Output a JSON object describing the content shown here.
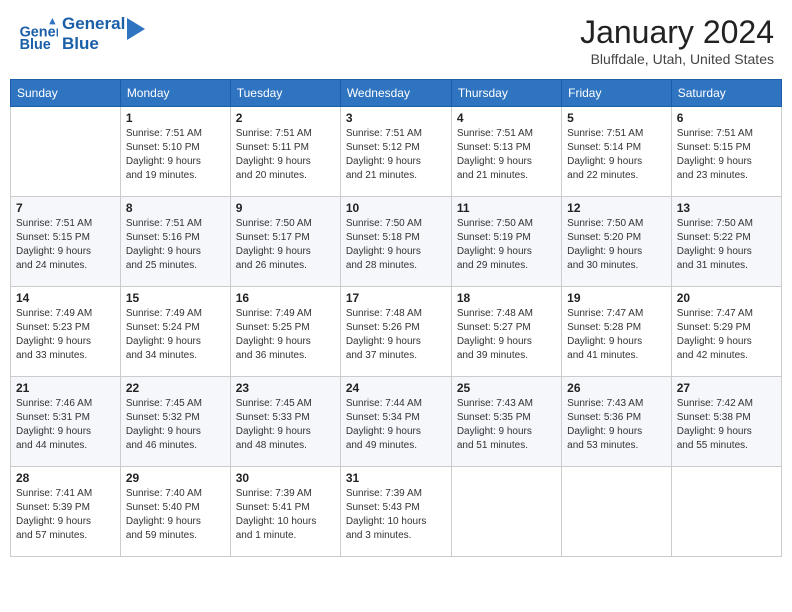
{
  "header": {
    "logo": {
      "line1": "General",
      "line2": "Blue"
    },
    "title": "January 2024",
    "location": "Bluffdale, Utah, United States"
  },
  "weekdays": [
    "Sunday",
    "Monday",
    "Tuesday",
    "Wednesday",
    "Thursday",
    "Friday",
    "Saturday"
  ],
  "weeks": [
    [
      {
        "day": "",
        "info": ""
      },
      {
        "day": "1",
        "info": "Sunrise: 7:51 AM\nSunset: 5:10 PM\nDaylight: 9 hours\nand 19 minutes."
      },
      {
        "day": "2",
        "info": "Sunrise: 7:51 AM\nSunset: 5:11 PM\nDaylight: 9 hours\nand 20 minutes."
      },
      {
        "day": "3",
        "info": "Sunrise: 7:51 AM\nSunset: 5:12 PM\nDaylight: 9 hours\nand 21 minutes."
      },
      {
        "day": "4",
        "info": "Sunrise: 7:51 AM\nSunset: 5:13 PM\nDaylight: 9 hours\nand 21 minutes."
      },
      {
        "day": "5",
        "info": "Sunrise: 7:51 AM\nSunset: 5:14 PM\nDaylight: 9 hours\nand 22 minutes."
      },
      {
        "day": "6",
        "info": "Sunrise: 7:51 AM\nSunset: 5:15 PM\nDaylight: 9 hours\nand 23 minutes."
      }
    ],
    [
      {
        "day": "7",
        "info": "Sunrise: 7:51 AM\nSunset: 5:15 PM\nDaylight: 9 hours\nand 24 minutes."
      },
      {
        "day": "8",
        "info": "Sunrise: 7:51 AM\nSunset: 5:16 PM\nDaylight: 9 hours\nand 25 minutes."
      },
      {
        "day": "9",
        "info": "Sunrise: 7:50 AM\nSunset: 5:17 PM\nDaylight: 9 hours\nand 26 minutes."
      },
      {
        "day": "10",
        "info": "Sunrise: 7:50 AM\nSunset: 5:18 PM\nDaylight: 9 hours\nand 28 minutes."
      },
      {
        "day": "11",
        "info": "Sunrise: 7:50 AM\nSunset: 5:19 PM\nDaylight: 9 hours\nand 29 minutes."
      },
      {
        "day": "12",
        "info": "Sunrise: 7:50 AM\nSunset: 5:20 PM\nDaylight: 9 hours\nand 30 minutes."
      },
      {
        "day": "13",
        "info": "Sunrise: 7:50 AM\nSunset: 5:22 PM\nDaylight: 9 hours\nand 31 minutes."
      }
    ],
    [
      {
        "day": "14",
        "info": "Sunrise: 7:49 AM\nSunset: 5:23 PM\nDaylight: 9 hours\nand 33 minutes."
      },
      {
        "day": "15",
        "info": "Sunrise: 7:49 AM\nSunset: 5:24 PM\nDaylight: 9 hours\nand 34 minutes."
      },
      {
        "day": "16",
        "info": "Sunrise: 7:49 AM\nSunset: 5:25 PM\nDaylight: 9 hours\nand 36 minutes."
      },
      {
        "day": "17",
        "info": "Sunrise: 7:48 AM\nSunset: 5:26 PM\nDaylight: 9 hours\nand 37 minutes."
      },
      {
        "day": "18",
        "info": "Sunrise: 7:48 AM\nSunset: 5:27 PM\nDaylight: 9 hours\nand 39 minutes."
      },
      {
        "day": "19",
        "info": "Sunrise: 7:47 AM\nSunset: 5:28 PM\nDaylight: 9 hours\nand 41 minutes."
      },
      {
        "day": "20",
        "info": "Sunrise: 7:47 AM\nSunset: 5:29 PM\nDaylight: 9 hours\nand 42 minutes."
      }
    ],
    [
      {
        "day": "21",
        "info": "Sunrise: 7:46 AM\nSunset: 5:31 PM\nDaylight: 9 hours\nand 44 minutes."
      },
      {
        "day": "22",
        "info": "Sunrise: 7:45 AM\nSunset: 5:32 PM\nDaylight: 9 hours\nand 46 minutes."
      },
      {
        "day": "23",
        "info": "Sunrise: 7:45 AM\nSunset: 5:33 PM\nDaylight: 9 hours\nand 48 minutes."
      },
      {
        "day": "24",
        "info": "Sunrise: 7:44 AM\nSunset: 5:34 PM\nDaylight: 9 hours\nand 49 minutes."
      },
      {
        "day": "25",
        "info": "Sunrise: 7:43 AM\nSunset: 5:35 PM\nDaylight: 9 hours\nand 51 minutes."
      },
      {
        "day": "26",
        "info": "Sunrise: 7:43 AM\nSunset: 5:36 PM\nDaylight: 9 hours\nand 53 minutes."
      },
      {
        "day": "27",
        "info": "Sunrise: 7:42 AM\nSunset: 5:38 PM\nDaylight: 9 hours\nand 55 minutes."
      }
    ],
    [
      {
        "day": "28",
        "info": "Sunrise: 7:41 AM\nSunset: 5:39 PM\nDaylight: 9 hours\nand 57 minutes."
      },
      {
        "day": "29",
        "info": "Sunrise: 7:40 AM\nSunset: 5:40 PM\nDaylight: 9 hours\nand 59 minutes."
      },
      {
        "day": "30",
        "info": "Sunrise: 7:39 AM\nSunset: 5:41 PM\nDaylight: 10 hours\nand 1 minute."
      },
      {
        "day": "31",
        "info": "Sunrise: 7:39 AM\nSunset: 5:43 PM\nDaylight: 10 hours\nand 3 minutes."
      },
      {
        "day": "",
        "info": ""
      },
      {
        "day": "",
        "info": ""
      },
      {
        "day": "",
        "info": ""
      }
    ]
  ]
}
